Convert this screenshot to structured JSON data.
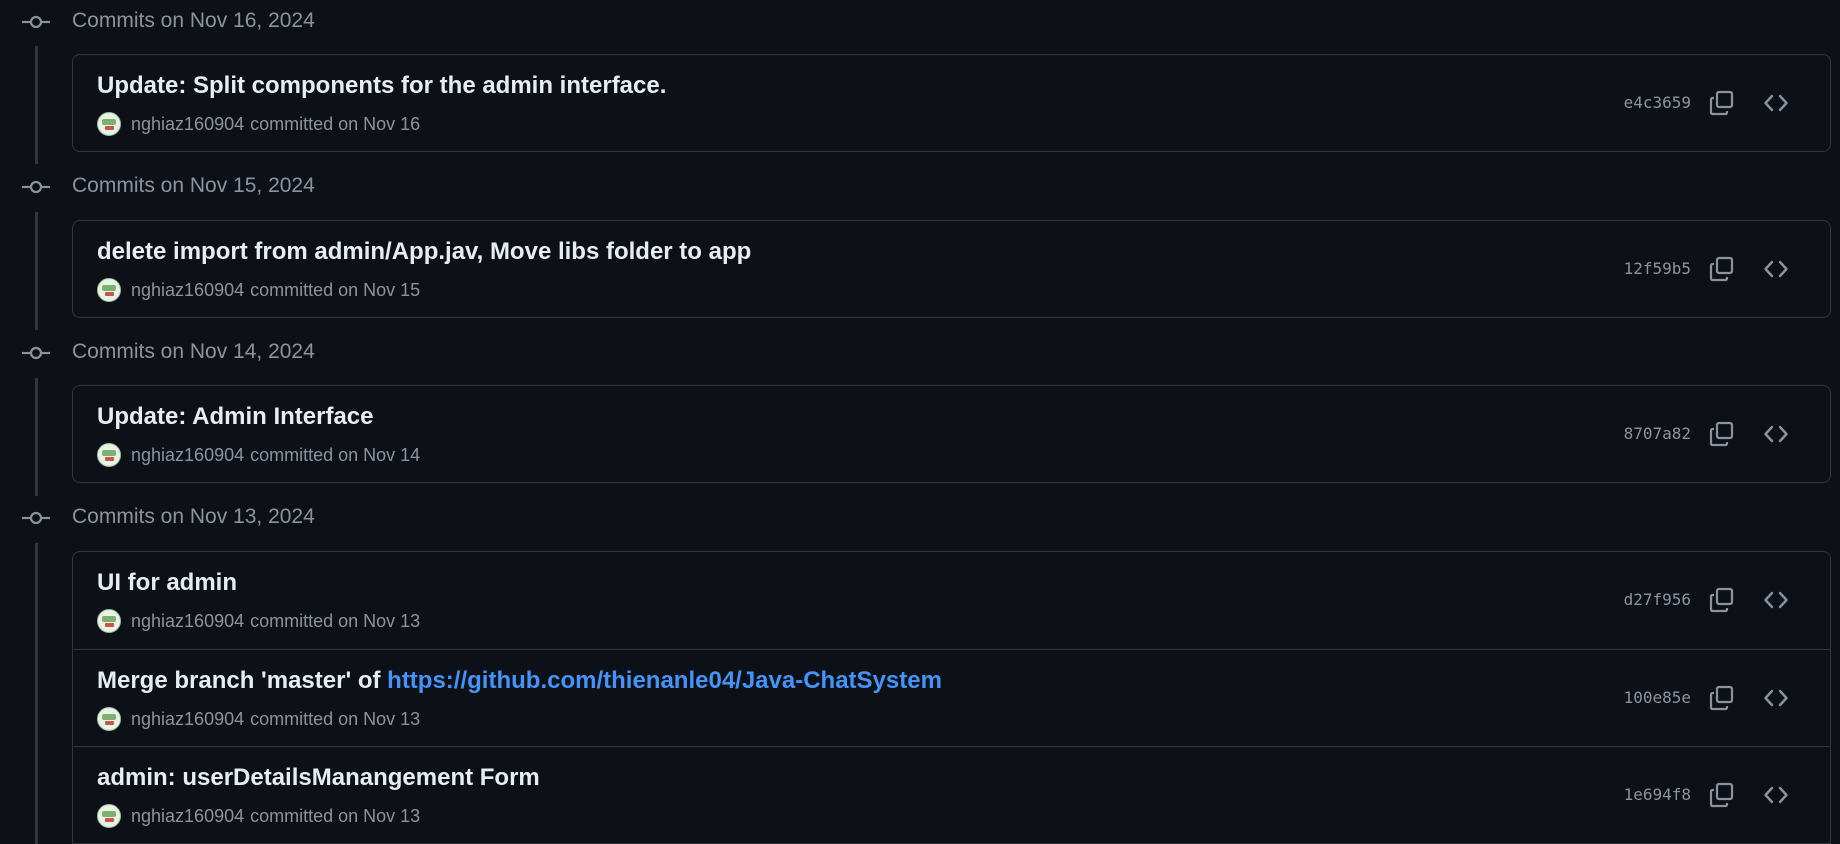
{
  "groups": [
    {
      "label": "Commits on Nov 16, 2024",
      "commits": [
        {
          "title": "Update: Split components for the admin interface.",
          "author": "nghiaz160904",
          "committed": "committed on Nov 16",
          "sha": "e4c3659"
        }
      ]
    },
    {
      "label": "Commits on Nov 15, 2024",
      "commits": [
        {
          "title": "delete import from admin/App.jav, Move libs folder to app",
          "author": "nghiaz160904",
          "committed": "committed on Nov 15",
          "sha": "12f59b5"
        }
      ]
    },
    {
      "label": "Commits on Nov 14, 2024",
      "commits": [
        {
          "title": "Update: Admin Interface",
          "author": "nghiaz160904",
          "committed": "committed on Nov 14",
          "sha": "8707a82"
        }
      ]
    },
    {
      "label": "Commits on Nov 13, 2024",
      "commits": [
        {
          "title": "UI for admin",
          "author": "nghiaz160904",
          "committed": "committed on Nov 13",
          "sha": "d27f956"
        },
        {
          "title": "Merge branch 'master' of ",
          "title_link": "https://github.com/thienanle04/Java-ChatSystem",
          "author": "nghiaz160904",
          "committed": "committed on Nov 13",
          "sha": "100e85e"
        },
        {
          "title": "admin: userDetailsManangement Form",
          "author": "nghiaz160904",
          "committed": "committed on Nov 13",
          "sha": "1e694f8"
        }
      ]
    }
  ],
  "icons": {
    "group": "git-commit-icon",
    "copy": "copy-icon",
    "browse": "code-icon"
  },
  "colors": {
    "background": "#0d1117",
    "border": "#30363d",
    "muted": "#8b949e",
    "text": "#e6edf3",
    "link": "#4493f8"
  }
}
